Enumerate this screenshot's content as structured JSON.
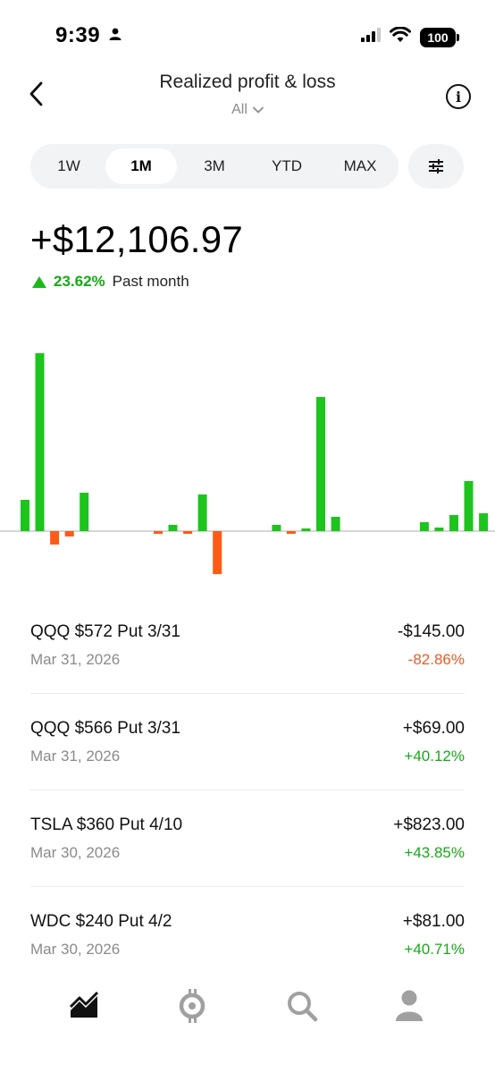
{
  "status_bar": {
    "time": "9:39",
    "battery": "100"
  },
  "header": {
    "title": "Realized profit & loss",
    "filter_label": "All"
  },
  "range_tabs": [
    {
      "label": "1W",
      "active": false
    },
    {
      "label": "1M",
      "active": true
    },
    {
      "label": "3M",
      "active": false
    },
    {
      "label": "YTD",
      "active": false
    },
    {
      "label": "MAX",
      "active": false
    }
  ],
  "summary": {
    "value": "+$12,106.97",
    "change_pct": "23.62%",
    "period": "Past month"
  },
  "colors": {
    "gain": "#1ec41e",
    "loss": "#ff5a16",
    "baseline": "#c9c9c9"
  },
  "chart_data": {
    "type": "bar",
    "values": [
      35,
      199,
      -15,
      -6,
      43,
      0,
      0,
      0,
      0,
      -3,
      7,
      -3,
      41,
      -48,
      0,
      0,
      0,
      7,
      -3,
      3,
      150,
      16,
      0,
      0,
      0,
      0,
      0,
      10,
      4,
      18,
      56,
      20,
      0,
      0,
      0,
      48,
      -3
    ],
    "ylim": [
      -60,
      220
    ],
    "grid": false
  },
  "trades": [
    {
      "name": "QQQ $572 Put 3/31",
      "date": "Mar 31, 2026",
      "amount": "-$145.00",
      "pct": "-82.86%",
      "positive": false
    },
    {
      "name": "QQQ $566 Put 3/31",
      "date": "Mar 31, 2026",
      "amount": "+$69.00",
      "pct": "+40.12%",
      "positive": true
    },
    {
      "name": "TSLA $360 Put 4/10",
      "date": "Mar 30, 2026",
      "amount": "+$823.00",
      "pct": "+43.85%",
      "positive": true
    },
    {
      "name": "WDC $240 Put 4/2",
      "date": "Mar 30, 2026",
      "amount": "+$81.00",
      "pct": "+40.71%",
      "positive": true
    }
  ],
  "nav": [
    {
      "icon": "chart-trend-icon",
      "active": true
    },
    {
      "icon": "crypto-icon",
      "active": false
    },
    {
      "icon": "search-icon",
      "active": false
    },
    {
      "icon": "account-icon",
      "active": false
    }
  ]
}
